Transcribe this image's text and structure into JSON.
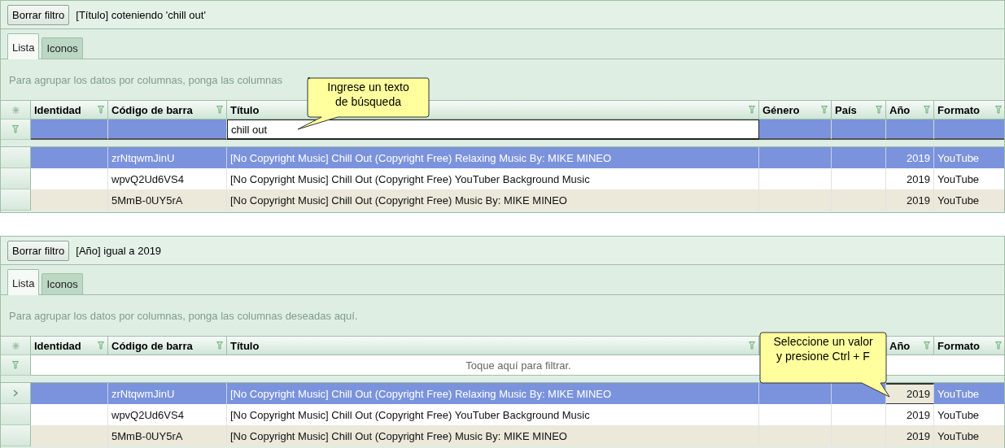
{
  "panels": [
    {
      "clear_button": "Borrar filtro",
      "filter_text": "[Título] coteniendo 'chill out'",
      "tabs": [
        {
          "label": "Lista",
          "selected": true
        },
        {
          "label": "Iconos",
          "selected": false
        }
      ],
      "group_hint": "Para agrupar los datos por columnas, ponga las columnas",
      "columns": [
        {
          "label": "Identidad"
        },
        {
          "label": "Código de barra"
        },
        {
          "label": "Título"
        },
        {
          "label": "Género"
        },
        {
          "label": "País"
        },
        {
          "label": "Año"
        },
        {
          "label": "Formato"
        }
      ],
      "filter_row": {
        "kind": "cells",
        "cells": [
          {
            "editing": false
          },
          {
            "editing": false
          },
          {
            "editing": true,
            "value": "chill out"
          },
          {
            "editing": false
          },
          {
            "editing": false
          },
          {
            "editing": false
          },
          {
            "editing": false
          }
        ]
      },
      "rows": [
        {
          "selected": true,
          "focus": false,
          "barcode": "zrNtqwmJinU",
          "title": "[No Copyright Music] Chill Out (Copyright Free) Relaxing Music By: MIKE MINEO",
          "year": "2019",
          "format": "YouTube"
        },
        {
          "selected": false,
          "focus": false,
          "barcode": "wpvQ2Ud6VS4",
          "title": "[No Copyright Music] Chill Out (Copyright Free) YouTuber Background Music",
          "year": "2019",
          "format": "YouTube"
        },
        {
          "selected": false,
          "focus": false,
          "barcode": "5MmB-0UY5rA",
          "title": "[No Copyright Music] Chill Out (Copyright Free) Music By: MIKE MINEO",
          "year": "2019",
          "format": "YouTube"
        }
      ],
      "callout": {
        "text": "Ingrese un texto\nde búsqueda"
      }
    },
    {
      "clear_button": "Borrar filtro",
      "filter_text": "[Año] igual a 2019",
      "tabs": [
        {
          "label": "Lista",
          "selected": true
        },
        {
          "label": "Iconos",
          "selected": false
        }
      ],
      "group_hint": "Para agrupar los datos por columnas, ponga las columnas deseadas aquí.",
      "columns": [
        {
          "label": "Identidad"
        },
        {
          "label": "Código de barra"
        },
        {
          "label": "Título"
        },
        {},
        {},
        {
          "label": "Año"
        },
        {
          "label": "Formato"
        }
      ],
      "filter_row": {
        "kind": "placeholder",
        "placeholder": "Toque aquí para filtrar."
      },
      "rows": [
        {
          "selected": true,
          "focus": true,
          "barcode": "zrNtqwmJinU",
          "title": "[No Copyright Music] Chill Out (Copyright Free) Relaxing Music By: MIKE MINEO",
          "year": "2019",
          "format": "YouTube"
        },
        {
          "selected": false,
          "focus": false,
          "barcode": "wpvQ2Ud6VS4",
          "title": "[No Copyright Music] Chill Out (Copyright Free) YouTuber Background Music",
          "year": "2019",
          "format": "YouTube"
        },
        {
          "selected": false,
          "focus": false,
          "barcode": "5MmB-0UY5rA",
          "title": "[No Copyright Music] Chill Out (Copyright Free) Music By: MIKE MINEO",
          "year": "2019",
          "format": "YouTube"
        }
      ],
      "callout": {
        "text": "Seleccione un valor\ny presione Ctrl + F"
      }
    }
  ]
}
